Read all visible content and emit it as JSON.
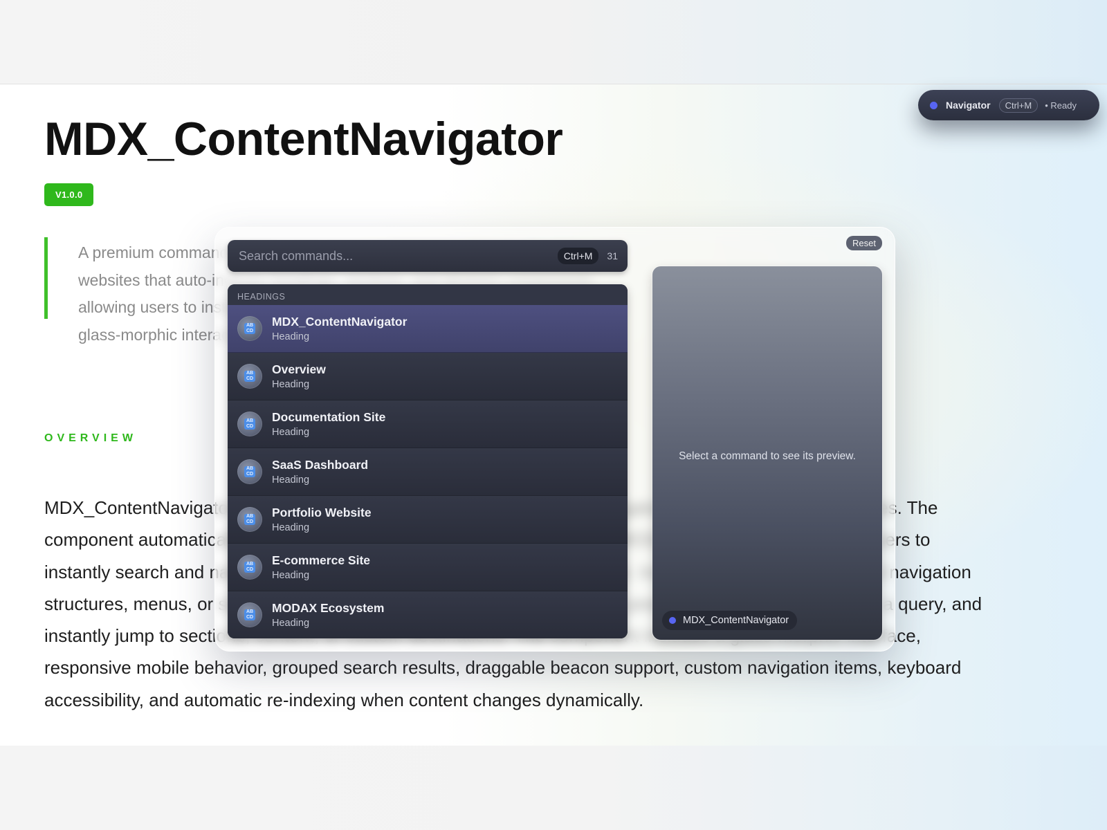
{
  "page": {
    "title": "MDX_ContentNavigator",
    "version": "V1.0.0",
    "intro": "A premium command palette and content navigation system for Framer websites that auto-indexes headings, sections, and MODAX components, allowing users to instantly navigate content through keyboard-first search and glass-morphic interactions.",
    "section_label": "OVERVIEW",
    "body": "MDX_ContentNavigator is a premium command palette and content navigation system for Framer websites. The component automatically indexes page headings, Framer sections, and MODAX components, allowing users to instantly search and navigate content through a keyboard-first experience. Instead of relying on traditional navigation structures, menus, or scrolling across large or complex pages, users can press a keyboard shortcut, type a query, and instantly jump to sections, content, or custom destinations. The component includes a glass-morphic interface, responsive mobile behavior, grouped search results, draggable beacon support, custom navigation items, keyboard accessibility, and automatic re-indexing when content changes dynamically."
  },
  "navigator_pill": {
    "label": "Navigator",
    "shortcut": "Ctrl+M",
    "status": "• Ready",
    "dot_color": "#5865f2"
  },
  "palette": {
    "reset_label": "Reset",
    "search": {
      "placeholder": "Search commands...",
      "value": "",
      "shortcut": "Ctrl+M",
      "count": "31"
    },
    "group_label": "HEADINGS",
    "items": [
      {
        "title": "MDX_ContentNavigator",
        "subtitle": "Heading",
        "icon": "heading-icon"
      },
      {
        "title": "Overview",
        "subtitle": "Heading",
        "icon": "heading-icon"
      },
      {
        "title": "Documentation Site",
        "subtitle": "Heading",
        "icon": "heading-icon"
      },
      {
        "title": "SaaS Dashboard",
        "subtitle": "Heading",
        "icon": "heading-icon"
      },
      {
        "title": "Portfolio Website",
        "subtitle": "Heading",
        "icon": "heading-icon"
      },
      {
        "title": "E-commerce Site",
        "subtitle": "Heading",
        "icon": "heading-icon"
      },
      {
        "title": "MODAX Ecosystem",
        "subtitle": "Heading",
        "icon": "heading-icon"
      }
    ],
    "preview": {
      "hint": "Select a command to see its preview.",
      "selected": "MDX_ContentNavigator"
    }
  },
  "colors": {
    "accent_green": "#2fb81c",
    "accent_indigo": "#5865f2",
    "palette_dark": "#2b2e3b"
  }
}
